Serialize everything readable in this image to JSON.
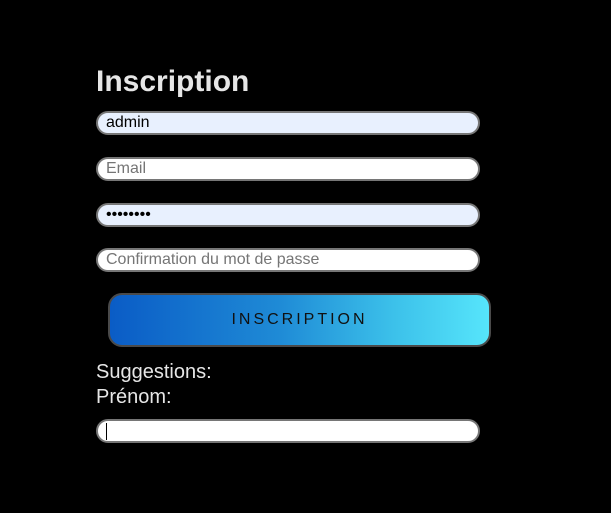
{
  "form": {
    "title": "Inscription",
    "username": {
      "value": "admin",
      "placeholder": ""
    },
    "email": {
      "value": "",
      "placeholder": "Email"
    },
    "password": {
      "value": "password",
      "placeholder": ""
    },
    "confirm_password": {
      "value": "",
      "placeholder": "Confirmation du mot de passe"
    },
    "submit_label": "Inscription",
    "suggestions_label": "Suggestions:",
    "prenom_label": "Prénom:",
    "prenom": {
      "value": "",
      "placeholder": ""
    }
  },
  "colors": {
    "background": "#000000",
    "text": "#e6e6e6",
    "autofill_field": "#e8f0fe",
    "button_gradient_start": "#0a5cc6",
    "button_gradient_end": "#56e5fb"
  }
}
